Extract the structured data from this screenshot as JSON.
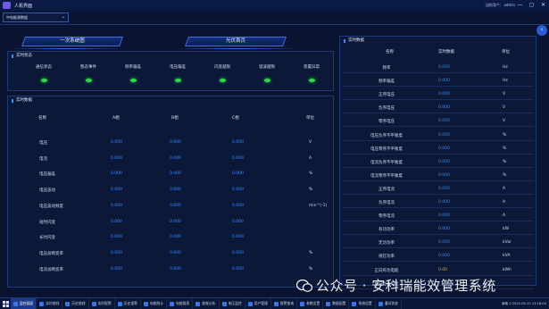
{
  "window": {
    "title": "人机界面",
    "user_text": "当前用户：  admin",
    "minimize": "—",
    "maximize": "▢",
    "close": "✕"
  },
  "selector": {
    "value": "中电能源数据"
  },
  "nav": {
    "tab_primary": "一次系统图",
    "tab_pv": "光伏首页"
  },
  "status_panel": {
    "title": "实时状态",
    "items": [
      {
        "label": "通信状态",
        "color": "#31d64a"
      },
      {
        "label": "暂态事件",
        "color": "#31d64a"
      },
      {
        "label": "频率偏差",
        "color": "#31d64a"
      },
      {
        "label": "电压偏差",
        "color": "#31d64a"
      },
      {
        "label": "闪变越限",
        "color": "#31d64a"
      },
      {
        "label": "谐波越限",
        "color": "#31d64a"
      },
      {
        "label": "装置异常",
        "color": "#31d64a"
      }
    ]
  },
  "phase_panel": {
    "title": "实时数据",
    "headers": {
      "name": "名称",
      "a": "A相",
      "b": "B相",
      "c": "C相",
      "unit": "单位"
    },
    "rows": [
      {
        "name": "电压",
        "a": "0.000",
        "b": "0.000",
        "c": "0.000",
        "unit": "V"
      },
      {
        "name": "电流",
        "a": "0.000",
        "b": "0.000",
        "c": "0.000",
        "unit": "A"
      },
      {
        "name": "电压偏差",
        "a": "0.000",
        "b": "0.000",
        "c": "0.000",
        "unit": "%"
      },
      {
        "name": "电压波动",
        "a": "0.000",
        "b": "0.000",
        "c": "0.000",
        "unit": "%"
      },
      {
        "name": "电压波动频度",
        "a": "0.000",
        "b": "0.000",
        "c": "0.000",
        "unit": "min^(-1)"
      },
      {
        "name": "短时闪变",
        "a": "0.000",
        "b": "0.000",
        "c": "0.000",
        "unit": ""
      },
      {
        "name": "长时闪变",
        "a": "0.000",
        "b": "0.000",
        "c": "0.000",
        "unit": ""
      },
      {
        "name": "电压总畸变率",
        "a": "0.000",
        "b": "0.000",
        "c": "0.000",
        "unit": "%"
      },
      {
        "name": "电流总畸变率",
        "a": "0.000",
        "b": "0.000",
        "c": "0.000",
        "unit": "%"
      }
    ]
  },
  "right_panel": {
    "title": "实时数据",
    "headers": {
      "name": "名称",
      "value": "实时数据",
      "unit": "单位"
    },
    "rows": [
      {
        "name": "频率",
        "value": "0.000",
        "unit": "Hz"
      },
      {
        "name": "频率偏差",
        "value": "0.000",
        "unit": "Hz"
      },
      {
        "name": "正序电压",
        "value": "0.000",
        "unit": "V"
      },
      {
        "name": "负序电压",
        "value": "0.000",
        "unit": "V"
      },
      {
        "name": "零序电压",
        "value": "0.000",
        "unit": "V"
      },
      {
        "name": "电压负序不平衡度",
        "value": "0.000",
        "unit": "%"
      },
      {
        "name": "电压零序不平衡度",
        "value": "0.000",
        "unit": "%"
      },
      {
        "name": "电流负序不平衡度",
        "value": "0.000",
        "unit": "%"
      },
      {
        "name": "电流零序不平衡度",
        "value": "0.000",
        "unit": "%"
      },
      {
        "name": "正序电流",
        "value": "0.000",
        "unit": "A"
      },
      {
        "name": "负序电流",
        "value": "0.000",
        "unit": "A"
      },
      {
        "name": "零序电流",
        "value": "0.000",
        "unit": "A"
      },
      {
        "name": "有功功率",
        "value": "0.000",
        "unit": "kW"
      },
      {
        "name": "无功功率",
        "value": "0.000",
        "unit": "kVar"
      },
      {
        "name": "视在功率",
        "value": "0.000",
        "unit": "kVA"
      },
      {
        "name": "正向有功电能",
        "value": "0.00",
        "unit": "kWh"
      },
      {
        "name": "反向有功电能",
        "value": "",
        "unit": ""
      }
    ]
  },
  "taskbar": {
    "items": [
      "监控画面",
      "实时曲线",
      "历史曲线",
      "实时报警",
      "历史报警",
      "电能统计",
      "电能报表",
      "能耗分析",
      "电压监控",
      "用户管理",
      "报警查询",
      "参数设置",
      "数据配置",
      "系统设置",
      "通讯状态"
    ],
    "active_index": 0,
    "tray_text": "事故 0   2025-09-10 13:18:04"
  },
  "watermark": {
    "text": "公众号 · 安科瑞能效管理系统"
  },
  "colors": {
    "accent": "#3d8bff",
    "status_ok": "#31d64a",
    "bg": "#0a1430"
  }
}
